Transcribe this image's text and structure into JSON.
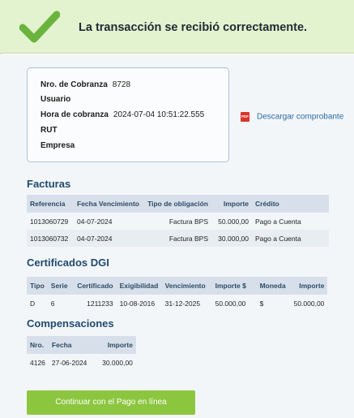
{
  "banner": {
    "message": "La transacción se recibió correctamente.",
    "check_color": "#6ab43e"
  },
  "info": {
    "cobranza_label": "Nro. de Cobranza",
    "cobranza_value": "8728",
    "usuario_label": "Usuario",
    "usuario_value": "",
    "hora_label": "Hora de cobranza",
    "hora_value": "2024-07-04 10:51:22.555",
    "rut_label": "RUT",
    "rut_value": "",
    "empresa_label": "Empresa",
    "empresa_value": ""
  },
  "download": {
    "icon_text": "PDF",
    "label": "Descargar comprobante"
  },
  "facturas": {
    "title": "Facturas",
    "headers": [
      "Referencia",
      "Fecha Vencimiento",
      "Tipo de obligación",
      "Importe",
      "Crédito"
    ],
    "rows": [
      [
        "1013060729",
        "04-07-2024",
        "Factura BPS",
        "50.000,00",
        "Pago a Cuenta"
      ],
      [
        "1013060732",
        "04-07-2024",
        "Factura BPS",
        "30.000,00",
        "Pago a Cuenta"
      ]
    ]
  },
  "certificados": {
    "title": "Certificados DGI",
    "headers": [
      "Tipo",
      "Serie",
      "Certificado",
      "Exigibilidad",
      "Vencimiento",
      "Importe $",
      "Moneda",
      "Importe"
    ],
    "rows": [
      [
        "D",
        "6",
        "1211233",
        "10-08-2016",
        "31-12-2025",
        "50.000,00",
        "$",
        "50.000,00"
      ]
    ]
  },
  "compensaciones": {
    "title": "Compensaciones",
    "headers": [
      "Nro.",
      "Fecha",
      "Importe"
    ],
    "rows": [
      [
        "4126",
        "27-06-2024",
        "30.000,00"
      ]
    ]
  },
  "actions": {
    "continue_label": "Continuar con el Pago en línea",
    "accent": "#8cc63f"
  }
}
